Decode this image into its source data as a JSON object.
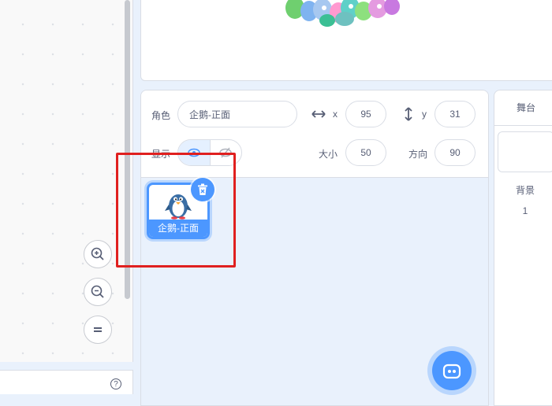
{
  "sprite_info": {
    "sprite_label": "角色",
    "sprite_name": "企鹅-正面",
    "x_label": "x",
    "x_value": "95",
    "y_label": "y",
    "y_value": "31",
    "show_label": "显示",
    "size_label": "大小",
    "size_value": "50",
    "direction_label": "方向",
    "direction_value": "90"
  },
  "sprite_list": {
    "items": [
      {
        "name": "企鹅-正面",
        "selected": true
      }
    ]
  },
  "stage_panel": {
    "tab_label": "舞台",
    "backdrops_label": "背景",
    "backdrops_count": "1"
  },
  "workspace": {
    "help_glyph": "?"
  },
  "colors": {
    "accent": "#4c97ff",
    "highlight_box": "#e0201f",
    "text": "#575e75"
  },
  "icons": [
    "zoom-in-icon",
    "zoom-out-icon",
    "zoom-reset-icon",
    "help-icon",
    "x-arrows-icon",
    "y-arrows-icon",
    "eye-icon",
    "eye-off-icon",
    "trash-icon",
    "choose-sprite-icon",
    "choose-backdrop-icon"
  ]
}
